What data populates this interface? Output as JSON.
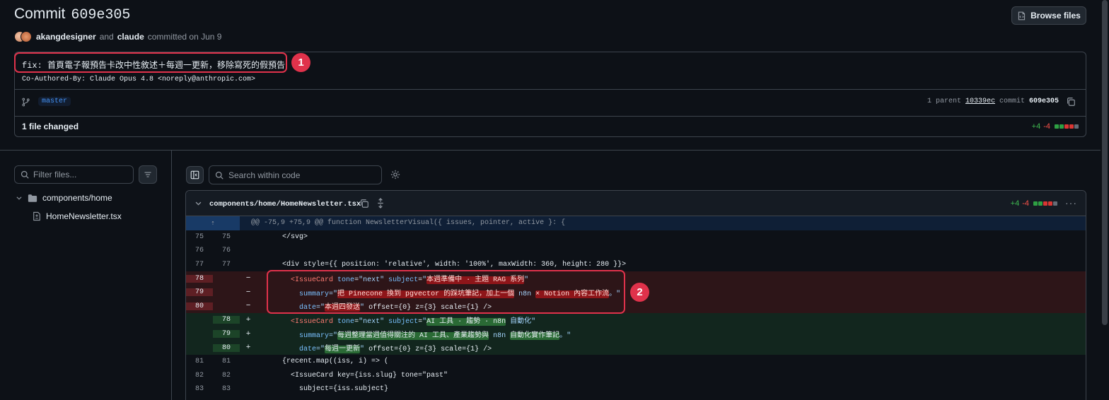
{
  "header": {
    "title_word": "Commit",
    "title_sha": "609e305",
    "browse_label": "Browse files"
  },
  "meta": {
    "author": "akangdesigner",
    "and": "and",
    "coauthor": "claude",
    "action": "committed on Jun 9"
  },
  "commit": {
    "message": "fix: 首頁電子報預告卡改中性敘述＋每週一更新，移除寫死的假預告",
    "coauthored": "Co-Authored-By: Claude Opus 4.8 <noreply@anthropic.com>",
    "branch": "master",
    "parent_count": "1 parent",
    "parent_hash": "10339ec",
    "commit_word": "commit",
    "commit_sha": "609e305",
    "files_changed": "1 file changed",
    "additions": "+4",
    "deletions": "-4"
  },
  "sidebar": {
    "filter_placeholder": "Filter files...",
    "folder": "components/home",
    "file": "HomeNewsletter.tsx"
  },
  "toolbar": {
    "search_placeholder": "Search within code"
  },
  "diff": {
    "file_path": "components/home/HomeNewsletter.tsx",
    "additions": "+4",
    "deletions": "-4",
    "hunk": "@@ -75,9 +75,9 @@ function NewsletterVisual({ issues, pointer, active }: {",
    "ctx_lines": [
      {
        "old": "75",
        "new": "75",
        "code": "      </svg>"
      },
      {
        "old": "76",
        "new": "76",
        "code": ""
      },
      {
        "old": "77",
        "new": "77",
        "code": "      <div style={{ position: 'relative', width: '100%', maxWidth: 360, height: 280 }}>"
      }
    ],
    "del_lines": [
      {
        "old": "78",
        "marker": "−"
      },
      {
        "old": "79",
        "marker": "−"
      },
      {
        "old": "80",
        "marker": "−"
      }
    ],
    "del_text": {
      "l1_tag": "<IssueCard",
      "l1_attr1": "tone",
      "l1_val1": "\"next\"",
      "l1_attr2": "subject",
      "l1_val2_pre": "\"",
      "l1_val2_hl": "本週準備中 · 主題 RAG 系列",
      "l1_val2_post": "\"",
      "l2_attr": "summary",
      "l2_pre": "=\"",
      "l2_hl1": "把 Pinecone 換到 pgvector 的踩坑筆記，加上一個",
      "l2_mid": " n8n ",
      "l2_hl2": "× Notion 內容工作流",
      "l2_post": "。\"",
      "l3_attr": "date",
      "l3_pre": "=\"",
      "l3_hl": "本週四發送",
      "l3_post": "\"",
      "l3_rest": " offset={0} z={3} scale={1} />"
    },
    "add_lines": [
      {
        "new": "78",
        "marker": "+"
      },
      {
        "new": "79",
        "marker": "+"
      },
      {
        "new": "80",
        "marker": "+"
      }
    ],
    "add_text": {
      "l1_tag": "<IssueCard",
      "l1_attr1": "tone",
      "l1_val1": "\"next\"",
      "l1_attr2": "subject",
      "l1_val2_pre": "\"",
      "l1_val2_hl": "AI 工具 · 趨勢 · n8n",
      "l1_val2_post": " 自動化\"",
      "l2_attr": "summary",
      "l2_pre": "=\"",
      "l2_hl1": "每週整理當週值得關注的 AI 工具、產業趨勢與",
      "l2_mid": " n8n ",
      "l2_hl2": "自動化實作筆記",
      "l2_post": "。\"",
      "l3_attr": "date",
      "l3_pre": "=\"",
      "l3_hl": "每週一更新",
      "l3_post": "\"",
      "l3_rest": " offset={0} z={3} scale={1} />"
    },
    "tail_lines": [
      {
        "old": "81",
        "new": "81",
        "code": "      {recent.map((iss, i) => ("
      },
      {
        "old": "82",
        "new": "82",
        "code": "        <IssueCard key={iss.slug} tone=\"past\""
      },
      {
        "old": "83",
        "new": "83",
        "code": "          subject={iss.subject}"
      }
    ]
  },
  "annotations": {
    "badge1": "1",
    "badge2": "2"
  }
}
